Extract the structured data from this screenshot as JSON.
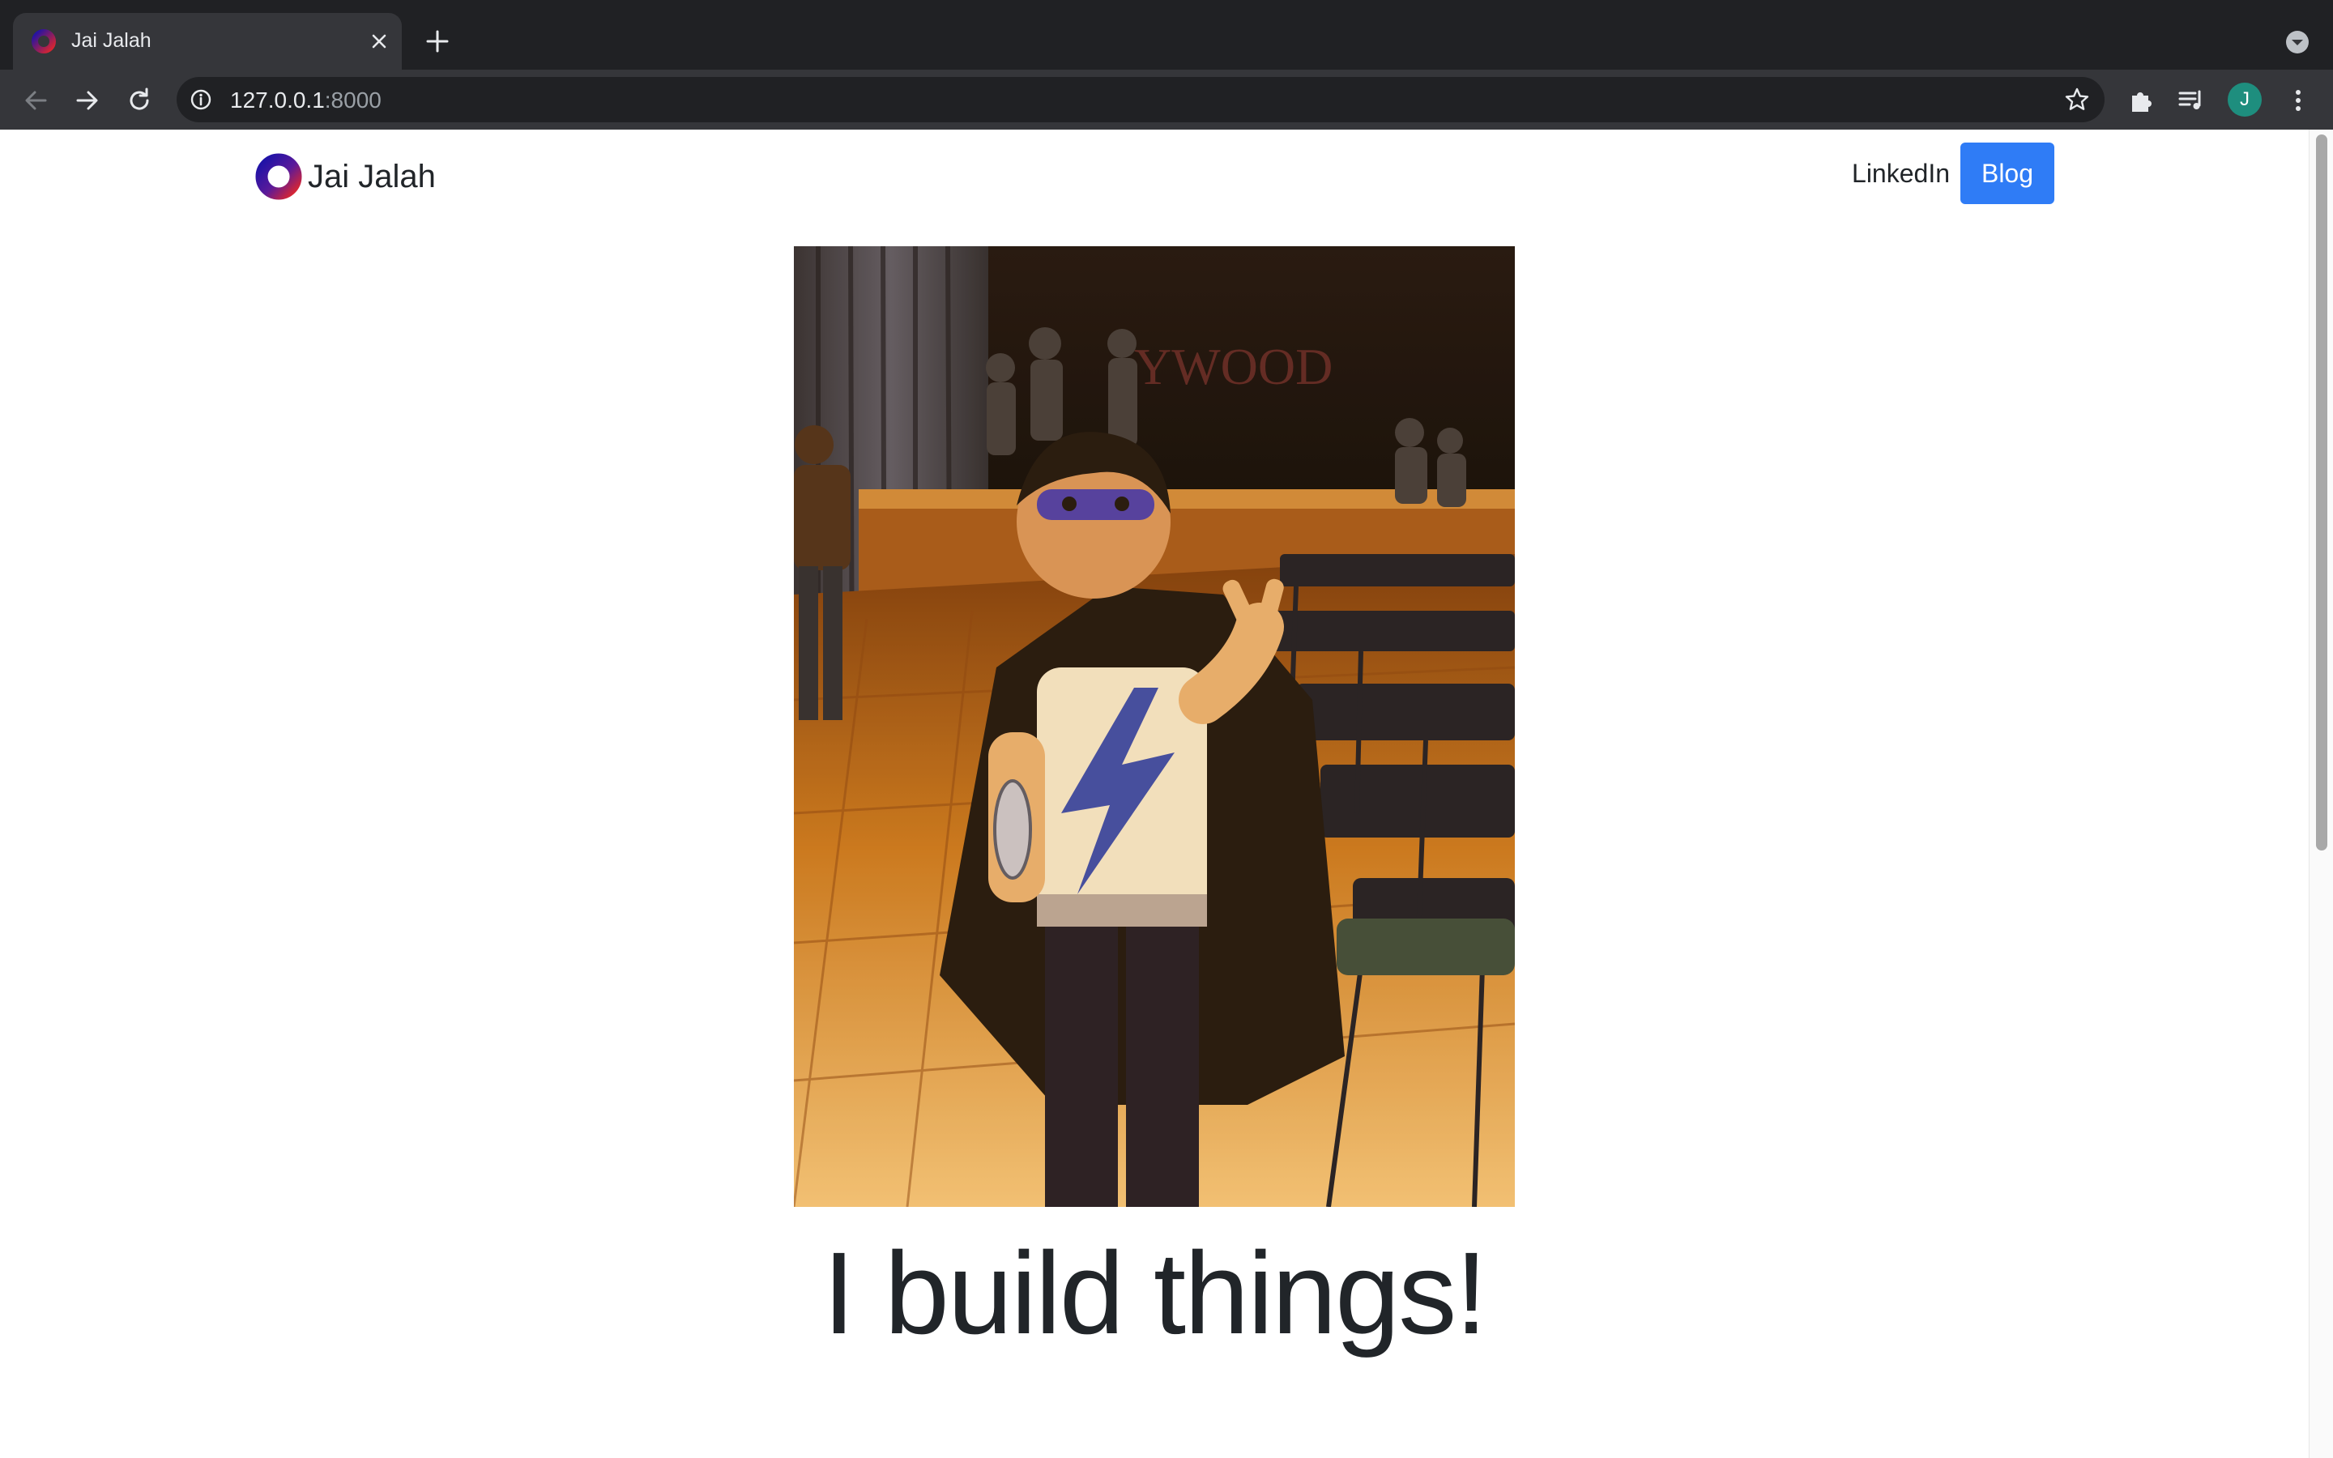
{
  "browser": {
    "tab": {
      "title": "Jai Jalah",
      "favicon": "ring-logo-icon"
    },
    "address_bar": {
      "host": "127.0.0.1",
      "port": ":8000"
    },
    "profile_initial": "J"
  },
  "site": {
    "brand_name": "Jai Jalah",
    "nav": {
      "linkedin_label": "LinkedIn",
      "blog_label": "Blog"
    },
    "hero_heading": "I build things!"
  },
  "colors": {
    "accent_blue": "#2f7cf6",
    "logo_gradient_start": "#1a12a8",
    "logo_gradient_end": "#e0262c",
    "text_dark": "#212529",
    "chrome_dark": "#202124",
    "chrome_toolbar": "#35363a"
  }
}
